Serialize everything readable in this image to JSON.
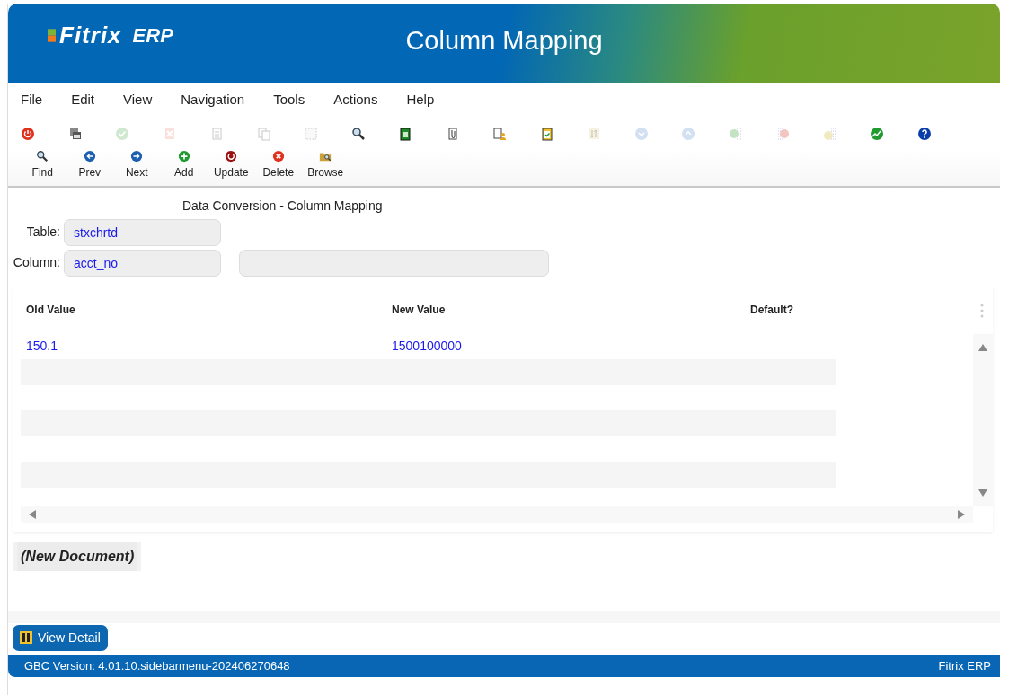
{
  "header": {
    "logo": "Fitrix",
    "logo_suffix": "ERP",
    "title": "Column Mapping"
  },
  "menu": [
    "File",
    "Edit",
    "View",
    "Navigation",
    "Tools",
    "Actions",
    "Help"
  ],
  "toolbar": [
    {
      "kind": "power",
      "disabled": false
    },
    {
      "kind": "windows",
      "disabled": false
    },
    {
      "kind": "check",
      "disabled": true
    },
    {
      "kind": "cancel",
      "disabled": true
    },
    {
      "kind": "doc",
      "disabled": true
    },
    {
      "kind": "copy",
      "disabled": true
    },
    {
      "kind": "select",
      "disabled": true
    },
    {
      "kind": "zoom",
      "disabled": false
    },
    {
      "kind": "notepad",
      "disabled": false
    },
    {
      "kind": "attach",
      "disabled": false
    },
    {
      "kind": "docuser",
      "disabled": false
    },
    {
      "kind": "checklist",
      "disabled": false
    },
    {
      "kind": "sort",
      "disabled": true
    },
    {
      "kind": "down",
      "disabled": true
    },
    {
      "kind": "up",
      "disabled": true
    },
    {
      "kind": "insert",
      "disabled": true
    },
    {
      "kind": "remove",
      "disabled": true
    },
    {
      "kind": "append",
      "disabled": true
    },
    {
      "kind": "chart",
      "disabled": false
    },
    {
      "kind": "help",
      "disabled": false
    }
  ],
  "actions": [
    {
      "label": "Find",
      "kind": "zoom"
    },
    {
      "label": "Prev",
      "kind": "prev"
    },
    {
      "label": "Next",
      "kind": "next"
    },
    {
      "label": "Add",
      "kind": "add"
    },
    {
      "label": "Update",
      "kind": "update"
    },
    {
      "label": "Delete",
      "kind": "delete"
    },
    {
      "label": "Browse",
      "kind": "browse"
    }
  ],
  "form": {
    "title": "Data Conversion - Column Mapping",
    "fields": [
      {
        "label": "Table:",
        "value": "stxchrtd"
      },
      {
        "label": "Column:",
        "value": "acct_no"
      }
    ]
  },
  "table": {
    "columns": [
      "Old Value",
      "New Value",
      "Default?"
    ],
    "rows": [
      {
        "old_value": "150.1",
        "new_value": "1500100000"
      }
    ]
  },
  "document_status": "(New Document)",
  "detail_button": "View Detail",
  "status_bar": {
    "version": "GBC Version: 4.01.10.sidebarmenu-202406270648",
    "app": "Fitrix ERP"
  }
}
